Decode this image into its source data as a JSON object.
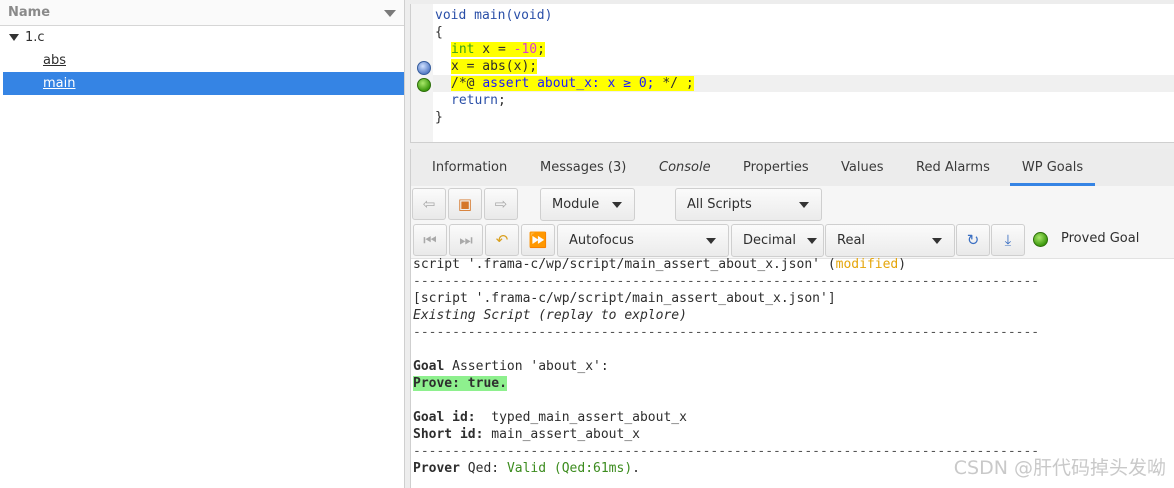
{
  "tree": {
    "header": "Name",
    "items": [
      {
        "label": "1.c"
      },
      {
        "label": "abs"
      },
      {
        "label": "main"
      }
    ]
  },
  "source": {
    "lines": [
      "void main(void)",
      "{",
      "int",
      " x = ",
      "-10",
      ";",
      "x = abs(x);",
      "/*@ ",
      "assert",
      " about_x: x ≥ 0; ",
      "*/ ;",
      "return",
      ";",
      "}"
    ]
  },
  "tabs": [
    "Information",
    "Messages (3)",
    "Console",
    "Properties",
    "Values",
    "Red Alarms",
    "WP Goals"
  ],
  "toolbar": {
    "module_label": "Module",
    "scripts_label": "All Scripts",
    "autofocus_label": "Autofocus",
    "decimal_label": "Decimal",
    "real_label": "Real",
    "proved_label": "Proved Goal"
  },
  "output": {
    "l1_a": "script '.frama-c/wp/script/main_assert_about_x.json' (",
    "l1_b": "modified",
    "l1_c": ")",
    "dashes": "--------------------------------------------------------------------------------",
    "l3": "[script '.frama-c/wp/script/main_assert_about_x.json']",
    "l4": "Existing Script (replay to explore)",
    "goal_kw": "Goal",
    "goal_rest": " Assertion 'about_x':",
    "prove": "Prove: true.",
    "goalid_kw": "Goal id:",
    "goalid_val": "  typed_main_assert_about_x",
    "shortid_kw": "Short id:",
    "shortid_val": " main_assert_about_x",
    "prover_kw": "Prover",
    "prover_mid": " Qed: ",
    "prover_val": "Valid (Qed:61ms)",
    "prover_end": "."
  },
  "watermark": "CSDN @肝代码掉头发呦",
  "colors": {
    "accent": "#3584e4",
    "highlight": "#ffff00",
    "valid": "#3c8c1e",
    "modified": "#e5a50a"
  }
}
